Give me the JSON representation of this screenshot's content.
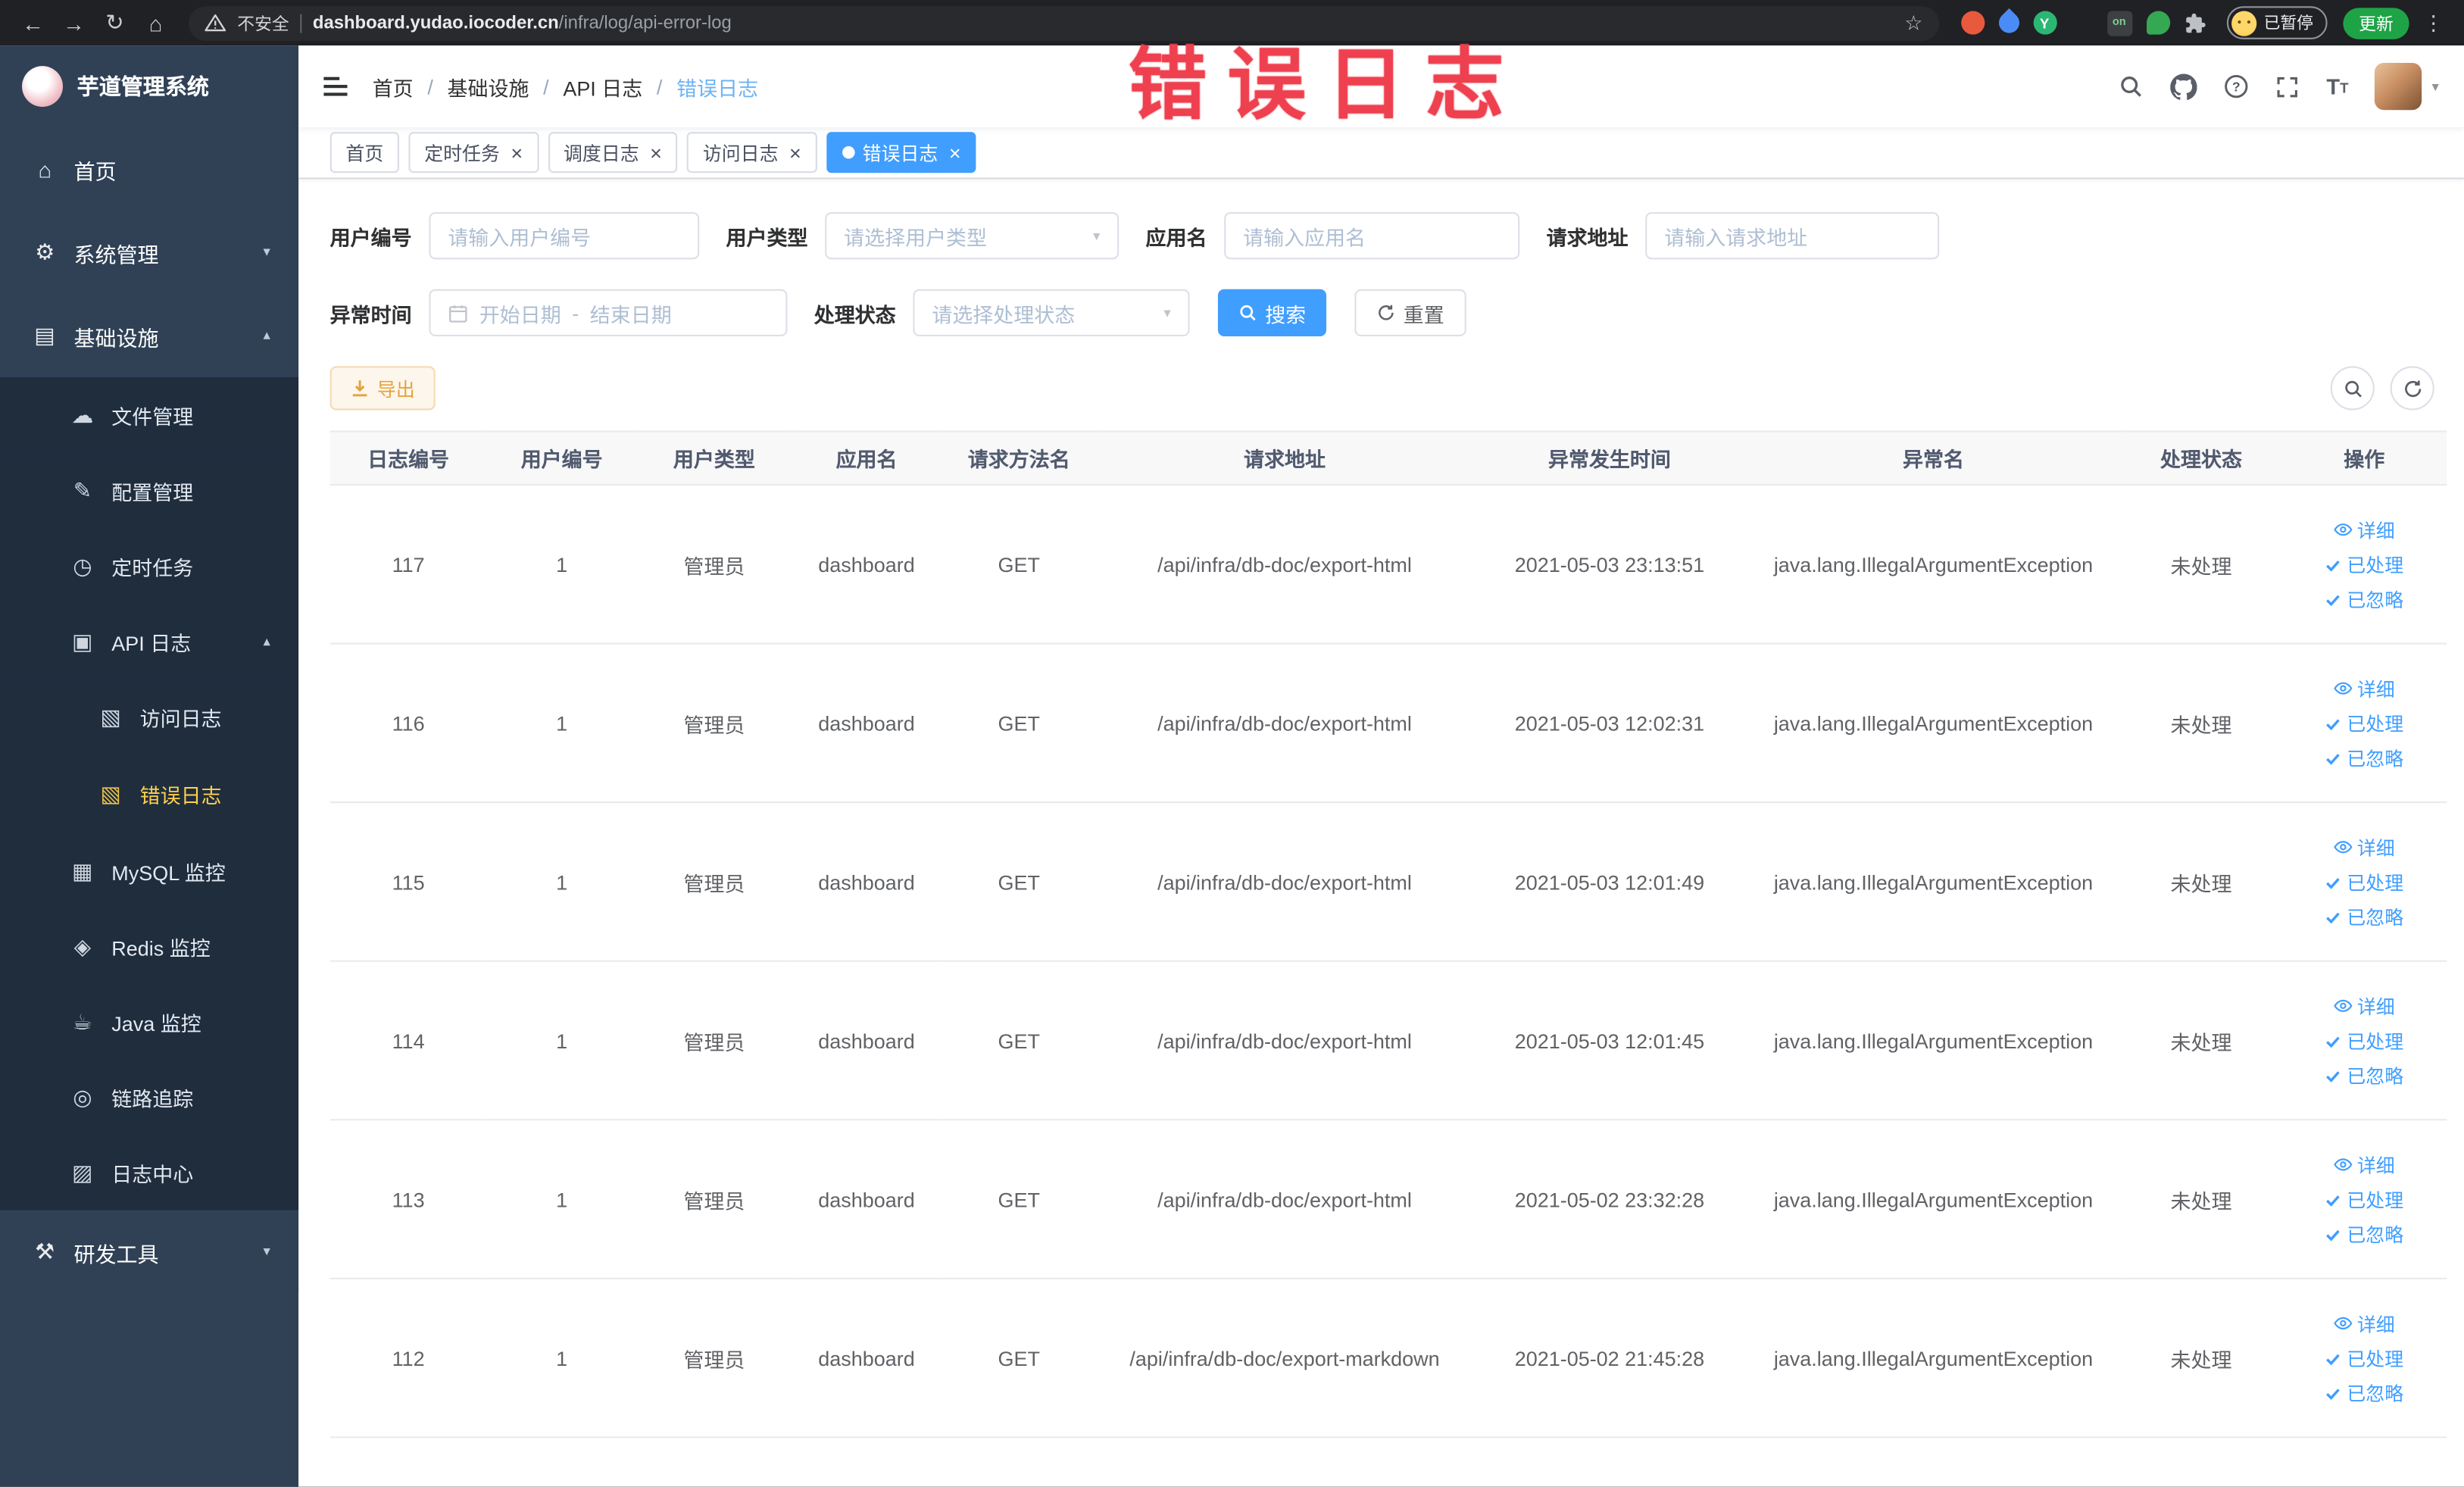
{
  "browser": {
    "security": "不安全",
    "url_host": "dashboard.yudao.iocoder.cn",
    "url_path": "/infra/log/api-error-log",
    "ext_on": "on",
    "ext_y": "Y",
    "paused": "已暂停",
    "update": "更新"
  },
  "watermark": "错误日志",
  "sidebar": {
    "title": "芋道管理系统",
    "menu": [
      {
        "name": "home",
        "label": "首页",
        "icon": "home-icon",
        "level": 0
      },
      {
        "name": "system",
        "label": "系统管理",
        "icon": "gear-icon",
        "level": 0,
        "arrow": "down"
      },
      {
        "name": "infra",
        "label": "基础设施",
        "icon": "infra-icon",
        "level": 0,
        "arrow": "up"
      },
      {
        "name": "file",
        "label": "文件管理",
        "icon": "cloud-icon",
        "level": 1
      },
      {
        "name": "config",
        "label": "配置管理",
        "icon": "edit-icon",
        "level": 1
      },
      {
        "name": "job",
        "label": "定时任务",
        "icon": "timer-icon",
        "level": 1
      },
      {
        "name": "api-log",
        "label": "API 日志",
        "icon": "log-icon",
        "level": 1,
        "arrow": "up"
      },
      {
        "name": "access-log",
        "label": "访问日志",
        "icon": "doc-icon",
        "level": 2
      },
      {
        "name": "error-log",
        "label": "错误日志",
        "icon": "doc-icon",
        "level": 2,
        "active": true
      },
      {
        "name": "mysql",
        "label": "MySQL 监控",
        "icon": "mysql-icon",
        "level": 1
      },
      {
        "name": "redis",
        "label": "Redis 监控",
        "icon": "redis-icon",
        "level": 1
      },
      {
        "name": "java",
        "label": "Java 监控",
        "icon": "java-icon",
        "level": 1
      },
      {
        "name": "trace",
        "label": "链路追踪",
        "icon": "trace-icon",
        "level": 1
      },
      {
        "name": "log-center",
        "label": "日志中心",
        "icon": "log-center-icon",
        "level": 1
      },
      {
        "name": "devtool",
        "label": "研发工具",
        "icon": "tool-icon",
        "level": 0,
        "arrow": "down"
      }
    ]
  },
  "header": {
    "breadcrumb": [
      "首页",
      "基础设施",
      "API 日志",
      "错误日志"
    ]
  },
  "tabs": [
    {
      "label": "首页",
      "closable": false,
      "active": false
    },
    {
      "label": "定时任务",
      "closable": true,
      "active": false
    },
    {
      "label": "调度日志",
      "closable": true,
      "active": false
    },
    {
      "label": "访问日志",
      "closable": true,
      "active": false
    },
    {
      "label": "错误日志",
      "closable": true,
      "active": true
    }
  ],
  "filters": {
    "user_id": {
      "label": "用户编号",
      "placeholder": "请输入用户编号"
    },
    "user_type": {
      "label": "用户类型",
      "placeholder": "请选择用户类型"
    },
    "app_name": {
      "label": "应用名",
      "placeholder": "请输入应用名"
    },
    "request_url": {
      "label": "请求地址",
      "placeholder": "请输入请求地址"
    },
    "exception_time": {
      "label": "异常时间",
      "start": "开始日期",
      "separator": "-",
      "end": "结束日期"
    },
    "process_status": {
      "label": "处理状态",
      "placeholder": "请选择处理状态"
    },
    "search": "搜索",
    "reset": "重置"
  },
  "toolbar": {
    "export": "导出"
  },
  "table": {
    "columns": [
      "日志编号",
      "用户编号",
      "用户类型",
      "应用名",
      "请求方法名",
      "请求地址",
      "异常发生时间",
      "异常名",
      "处理状态",
      "操作"
    ],
    "actions": [
      "详细",
      "已处理",
      "已忽略"
    ],
    "rows": [
      {
        "id": "117",
        "user_id": "1",
        "user_type": "管理员",
        "app": "dashboard",
        "method": "GET",
        "url": "/api/infra/db-doc/export-html",
        "time": "2021-05-03 23:13:51",
        "exception": "java.lang.IllegalArgumentException",
        "status": "未处理"
      },
      {
        "id": "116",
        "user_id": "1",
        "user_type": "管理员",
        "app": "dashboard",
        "method": "GET",
        "url": "/api/infra/db-doc/export-html",
        "time": "2021-05-03 12:02:31",
        "exception": "java.lang.IllegalArgumentException",
        "status": "未处理"
      },
      {
        "id": "115",
        "user_id": "1",
        "user_type": "管理员",
        "app": "dashboard",
        "method": "GET",
        "url": "/api/infra/db-doc/export-html",
        "time": "2021-05-03 12:01:49",
        "exception": "java.lang.IllegalArgumentException",
        "status": "未处理"
      },
      {
        "id": "114",
        "user_id": "1",
        "user_type": "管理员",
        "app": "dashboard",
        "method": "GET",
        "url": "/api/infra/db-doc/export-html",
        "time": "2021-05-03 12:01:45",
        "exception": "java.lang.IllegalArgumentException",
        "status": "未处理"
      },
      {
        "id": "113",
        "user_id": "1",
        "user_type": "管理员",
        "app": "dashboard",
        "method": "GET",
        "url": "/api/infra/db-doc/export-html",
        "time": "2021-05-02 23:32:28",
        "exception": "java.lang.IllegalArgumentException",
        "status": "未处理"
      },
      {
        "id": "112",
        "user_id": "1",
        "user_type": "管理员",
        "app": "dashboard",
        "method": "GET",
        "url": "/api/infra/db-doc/export-markdown",
        "time": "2021-05-02 21:45:28",
        "exception": "java.lang.IllegalArgumentException",
        "status": "未处理"
      }
    ]
  }
}
